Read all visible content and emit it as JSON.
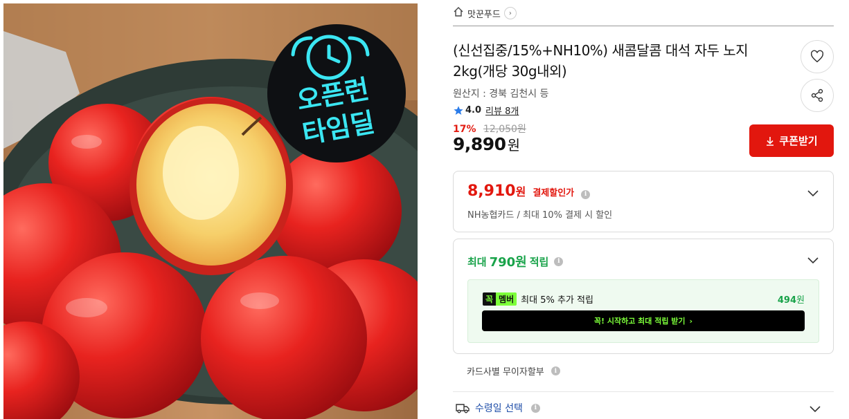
{
  "colors": {
    "accent_red": "#e2170e",
    "green": "#19a34a",
    "member_green": "#7dff3a",
    "star_blue": "#2b7ce9"
  },
  "image": {
    "badge_line1": "오픈런",
    "badge_line2": "타임딜"
  },
  "breadcrumb": {
    "home_icon": "home-icon",
    "store_name": "맛꾼푸드",
    "arrow_icon": "chevron-right-icon"
  },
  "product": {
    "title": "(신선집중/15%+NH10%) 새콤달콤 대석 자두 노지 2kg(개당 30g내외)",
    "origin": "원산지 : 경북 김천시 등",
    "rating": "4.0",
    "review_label": "리뷰 8개",
    "discount_rate": "17%",
    "original_price": "12,050원",
    "price": "9,890",
    "price_unit": "원"
  },
  "actions": {
    "wishlist_icon": "heart-icon",
    "share_icon": "share-icon",
    "coupon_label": "쿠폰받기"
  },
  "card_discount": {
    "price": "8,910",
    "unit": "원",
    "label": "결제할인가",
    "description": "NH농협카드 / 최대 10% 결제 시 할인"
  },
  "points": {
    "prefix": "최대",
    "amount": "790원",
    "suffix": "적립",
    "member_badge_1": "꼭",
    "member_badge_2": "멤버",
    "member_text": "최대 5% 추가 적립",
    "member_amount": "494",
    "member_amount_unit": "원",
    "member_button": "꼭! 시작하고 최대 적립 받기"
  },
  "installment": {
    "label": "카드사별 무이자할부"
  },
  "delivery": {
    "label": "수령일 선택"
  }
}
